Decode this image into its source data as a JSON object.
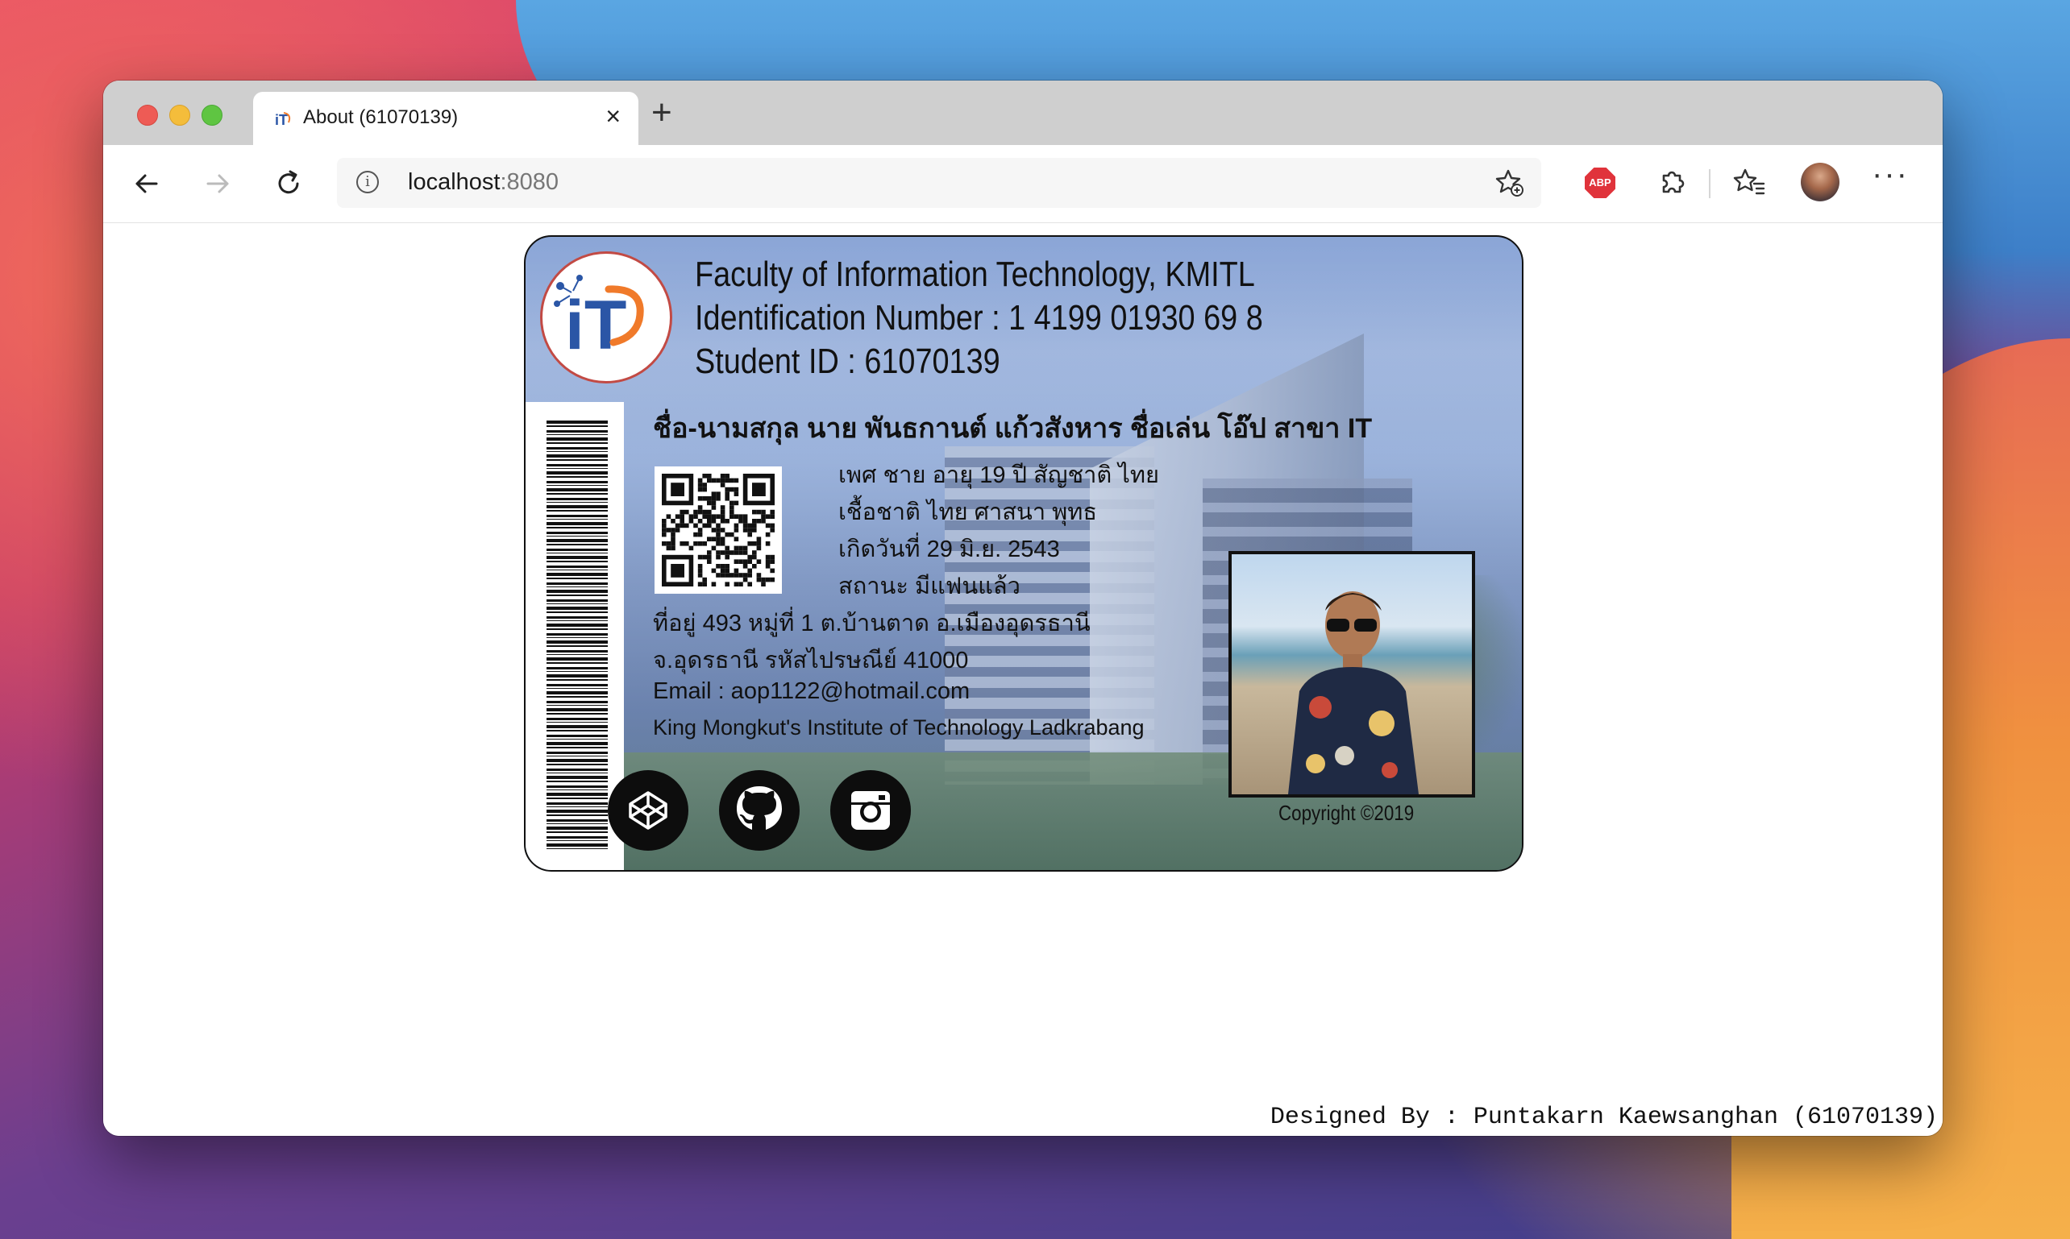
{
  "browser": {
    "tab_title": "About (61070139)",
    "url_host": "localhost",
    "url_port": ":8080",
    "new_tab_label": "+",
    "close_label": "×",
    "more_label": "···",
    "abp_label": "ABP"
  },
  "card": {
    "faculty": "Faculty of Information Technology, KMITL",
    "identification": "Identification Number : 1 4199 01930 69 8",
    "student_id": "Student ID : 61070139",
    "logo_text": "iT",
    "name_line": "ชื่อ-นามสกุล นาย พันธกานต์ แก้วสังหาร ชื่อเล่น โอ๊ป สาขา IT",
    "info": [
      "เพศ ชาย อายุ 19 ปี สัญชาติ ไทย",
      "เชื้อชาติ ไทย ศาสนา พุทธ",
      "เกิดวันที่ 29 มิ.ย. 2543",
      "สถานะ มีแฟนแล้ว"
    ],
    "address": [
      "ที่อยู่ 493 หมู่ที่ 1 ต.บ้านตาด อ.เมืองอุดรธานี",
      "จ.อุดรธานี รหัสไปรษณีย์ 41000",
      "Email : aop1122@hotmail.com",
      "King Mongkut's Institute of Technology Ladkrabang"
    ],
    "copyright": "Copyright ©2019",
    "social_icons": [
      "codepen-icon",
      "github-icon",
      "instagram-icon"
    ]
  },
  "footer": {
    "designed_by": "Designed By : Puntakarn Kaewsanghan (61070139)"
  },
  "colors": {
    "traffic_red": "#ee5b55",
    "traffic_yellow": "#f4bd3b",
    "traffic_green": "#5fc542",
    "logo_blue": "#2b56a6",
    "logo_orange": "#f07a2a",
    "abp_red": "#e0333b"
  }
}
